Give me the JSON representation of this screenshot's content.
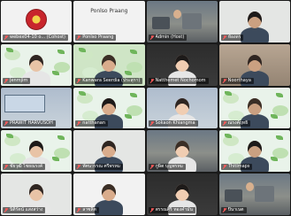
{
  "tiles": [
    {
      "name": "webex04-10 o... (Cohost)",
      "kind": "logo",
      "bg": "white"
    },
    {
      "name": "Ponlso Praang",
      "kind": "text-only",
      "bg": "white",
      "center": "Ponlso Praang"
    },
    {
      "name": "Admin (Host)",
      "kind": "office",
      "bg": "office"
    },
    {
      "name": "ห้องดร",
      "kind": "person",
      "bg": "pale"
    },
    {
      "name": "Jenmjim",
      "kind": "person",
      "bg": "mint"
    },
    {
      "name": "Kanwara Seerdia (ประสุกา)",
      "kind": "person",
      "bg": "green"
    },
    {
      "name": "Natthemet Nochomom",
      "kind": "person",
      "bg": "dark"
    },
    {
      "name": "Noorthaya",
      "kind": "person",
      "bg": "warm"
    },
    {
      "name": "PRAWIT HARVUSOH",
      "kind": "slide",
      "bg": "blue"
    },
    {
      "name": "natthanan",
      "kind": "person",
      "bg": "mint"
    },
    {
      "name": "Sokaon Khiangma",
      "kind": "person",
      "bg": "blue"
    },
    {
      "name": "ณรงค์ฤทธิ์",
      "kind": "person",
      "bg": "mint"
    },
    {
      "name": "ชัยวุฒิ ไชยณรงค์",
      "kind": "person",
      "bg": "mint"
    },
    {
      "name": "ทัศนวรรณ ศรีพรหม",
      "kind": "person",
      "bg": "pale"
    },
    {
      "name": "ภูษิต บุญพรหม",
      "kind": "person",
      "bg": "office"
    },
    {
      "name": "Thitlmaps",
      "kind": "person",
      "bg": "mint"
    },
    {
      "name": "นิติรัตน์ แสงสว่าง",
      "kind": "person",
      "bg": "pale"
    },
    {
      "name": "ลาซลิต",
      "kind": "person",
      "bg": "white"
    },
    {
      "name": "พรรณศิริ ทองคำมั่น",
      "kind": "person",
      "bg": "dark"
    },
    {
      "name": "ปินาเนต",
      "kind": "office",
      "bg": "office"
    }
  ]
}
